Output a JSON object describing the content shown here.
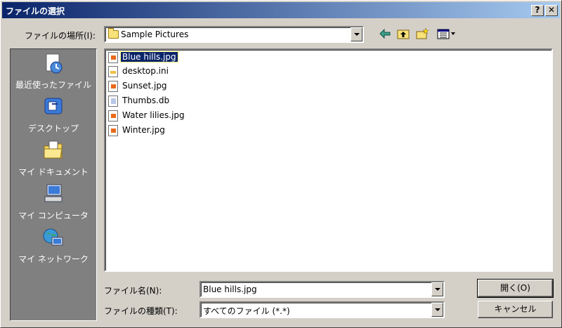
{
  "window": {
    "title": "ファイルの選択",
    "help_btn": "?",
    "close_btn": "✕"
  },
  "location": {
    "label": "ファイルの場所(I):",
    "value": "Sample Pictures",
    "toolbar_icons": [
      "back-arrow-icon",
      "up-folder-icon",
      "new-folder-icon",
      "view-menu-icon"
    ]
  },
  "places": [
    {
      "label": "最近使ったファイル",
      "icon": "recent-files-icon"
    },
    {
      "label": "デスクトップ",
      "icon": "desktop-icon"
    },
    {
      "label": "マイ ドキュメント",
      "icon": "my-documents-icon"
    },
    {
      "label": "マイ コンピュータ",
      "icon": "my-computer-icon"
    },
    {
      "label": "マイ ネットワーク",
      "icon": "my-network-icon"
    }
  ],
  "files": [
    {
      "name": "Blue hills.jpg",
      "type": "img",
      "selected": true
    },
    {
      "name": "desktop.ini",
      "type": "ini",
      "selected": false
    },
    {
      "name": "Sunset.jpg",
      "type": "img",
      "selected": false
    },
    {
      "name": "Thumbs.db",
      "type": "db",
      "selected": false
    },
    {
      "name": "Water lilies.jpg",
      "type": "img",
      "selected": false
    },
    {
      "name": "Winter.jpg",
      "type": "img",
      "selected": false
    }
  ],
  "filename": {
    "label": "ファイル名(N):",
    "value": "Blue hills.jpg"
  },
  "filetype": {
    "label": "ファイルの種類(T):",
    "value": "すべてのファイル (*.*)"
  },
  "buttons": {
    "open": "開く(O)",
    "cancel": "キャンセル"
  },
  "colors": {
    "titlebar_start": "#0a246a",
    "titlebar_end": "#a6caf0",
    "face": "#d4d0c8",
    "places_bg": "#808080",
    "selection": "#0a246a"
  }
}
